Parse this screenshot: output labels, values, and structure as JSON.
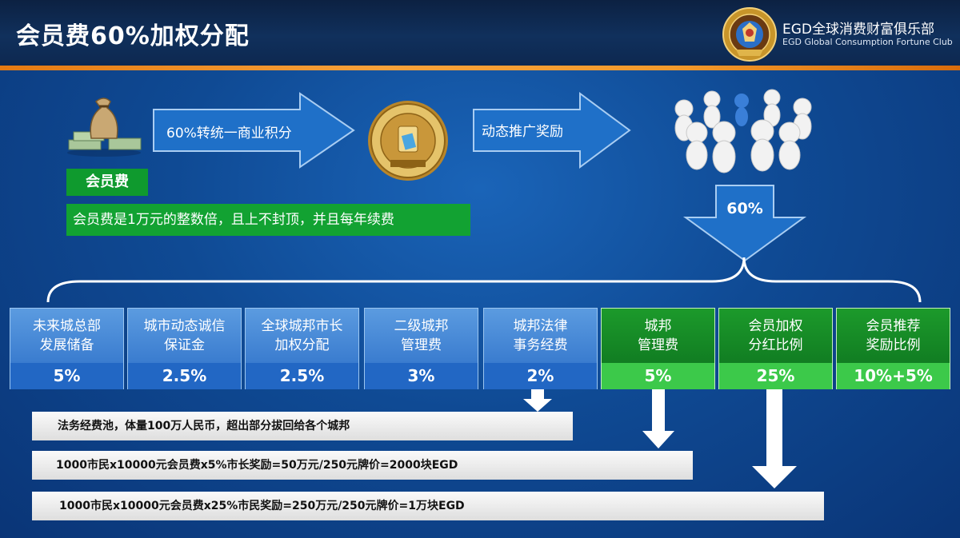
{
  "header": {
    "title": "会员费60%加权分配",
    "brand_cn": "EGD全球消费财富俱乐部",
    "brand_en": "EGD Global Consumption Fortune Club"
  },
  "flow": {
    "fee_label": "会员费",
    "fee_desc": "会员费是1万元的整数倍，且上不封顶，并且每年续费",
    "arrow1_label": "60%转统一商业积分",
    "arrow2_label": "动态推广奖励",
    "down_percent": "60%",
    "coin_icon": "egold-coin-icon",
    "people_icon": "people-circle-icon",
    "money_icon": "money-bag-icon"
  },
  "allocations": [
    {
      "name": "未来城总部发展储备",
      "line1": "未来城总部",
      "line2": "发展储备",
      "value": "5%",
      "style": "blue"
    },
    {
      "name": "城市动态诚信保证金",
      "line1": "城市动态诚信",
      "line2": "保证金",
      "value": "2.5%",
      "style": "blue"
    },
    {
      "name": "全球城邦市长加权分配",
      "line1": "全球城邦市长",
      "line2": "加权分配",
      "value": "2.5%",
      "style": "blue"
    },
    {
      "name": "二级城邦管理费",
      "line1": "二级城邦",
      "line2": "管理费",
      "value": "3%",
      "style": "blue"
    },
    {
      "name": "城邦法律事务经费",
      "line1": "城邦法律",
      "line2": "事务经费",
      "value": "2%",
      "style": "blue"
    },
    {
      "name": "城邦管理费",
      "line1": "城邦",
      "line2": "管理费",
      "value": "5%",
      "style": "green"
    },
    {
      "name": "会员加权分红比例",
      "line1": "会员加权",
      "line2": "分红比例",
      "value": "25%",
      "style": "green"
    },
    {
      "name": "会员推荐奖励比例",
      "line1": "会员推荐",
      "line2": "奖励比例",
      "value": "10%+5%",
      "style": "green"
    }
  ],
  "notes": [
    "法务经费池，体量100万人民币，超出部分拔回给各个城邦",
    "1000市民x10000元会员费x5%市长奖励=50万元/250元牌价=2000块EGD",
    "1000市民x10000元会员费x25%市民奖励=250万元/250元牌价=1万块EGD"
  ],
  "colors": {
    "background": "#0f4a94",
    "accent_orange": "#f39a2c",
    "green": "#0f9a2e",
    "blue_box": "#3a7ccf"
  }
}
